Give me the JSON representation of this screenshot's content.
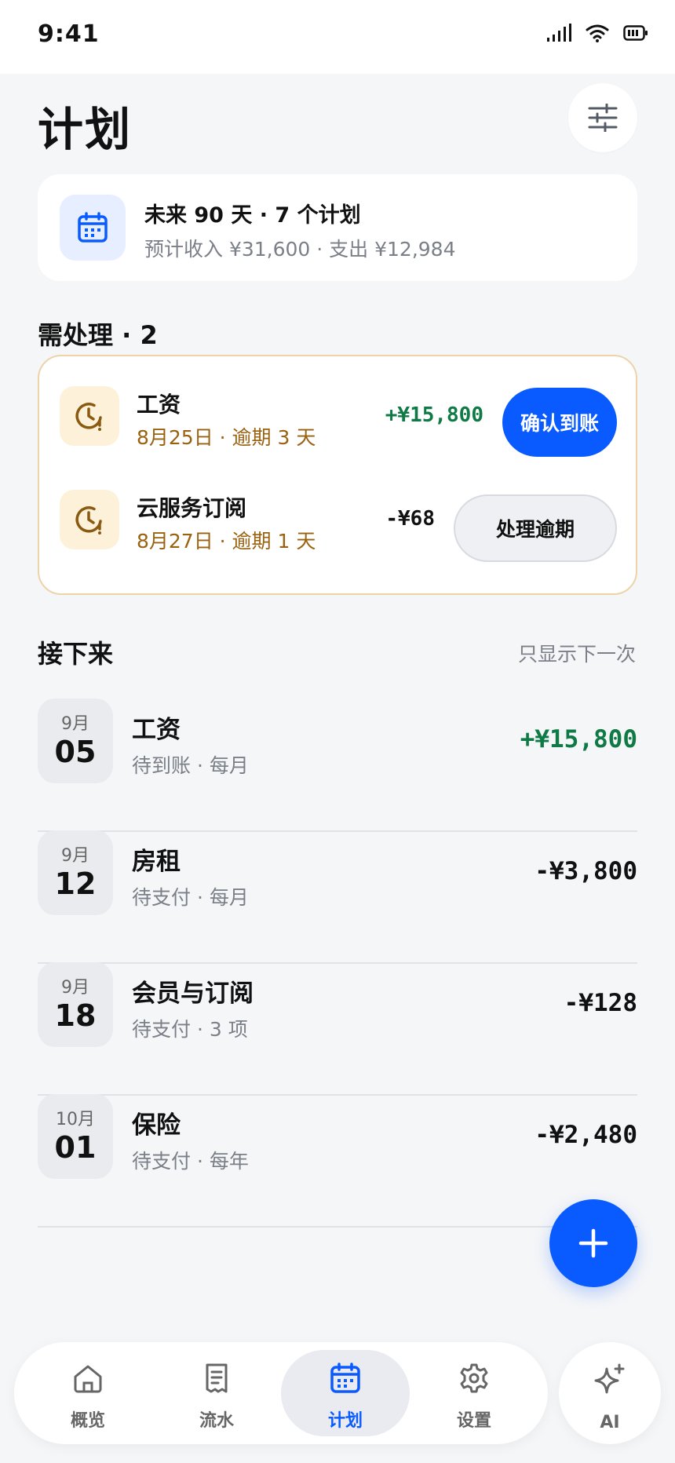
{
  "status_bar": {
    "time": "9:41"
  },
  "header": {
    "title": "计划",
    "filter_icon": "sliders-icon"
  },
  "summary": {
    "title": "未来 90 天 · 7 个计划",
    "subtitle": "预计收入 ¥31,600 · 支出 ¥12,984",
    "icon": "calendar-icon"
  },
  "attention": {
    "title": "需处理 · 2",
    "items": [
      {
        "name": "工资",
        "meta": "8月25日 · 逾期 3 天",
        "amount": "+¥15,800",
        "action": "确认到账"
      },
      {
        "name": "云服务订阅",
        "meta": "8月27日 · 逾期 1 天",
        "amount": "-¥68",
        "action": "处理逾期"
      }
    ]
  },
  "upcoming": {
    "title": "接下来",
    "filter_label": "只显示下一次",
    "items": [
      {
        "month": "9月",
        "day": "05",
        "name": "工资",
        "meta": "待到账 · 每月",
        "amount": "+¥15,800"
      },
      {
        "month": "9月",
        "day": "12",
        "name": "房租",
        "meta": "待支付 · 每月",
        "amount": "-¥3,800"
      },
      {
        "month": "9月",
        "day": "18",
        "name": "会员与订阅",
        "meta": "待支付 · 3 项",
        "amount": "-¥128"
      },
      {
        "month": "10月",
        "day": "01",
        "name": "保险",
        "meta": "待支付 · 每年",
        "amount": "-¥2,480"
      }
    ]
  },
  "tabs": [
    {
      "label": "概览",
      "icon": "home-icon"
    },
    {
      "label": "流水",
      "icon": "receipt-icon"
    },
    {
      "label": "计划",
      "icon": "calendar-icon",
      "active": true
    },
    {
      "label": "设置",
      "icon": "gear-icon"
    }
  ],
  "ai_button": {
    "label": "AI",
    "icon": "sparkle-icon"
  },
  "colors": {
    "accent": "#0a5bff",
    "income": "#0f7a45",
    "overdue": "#9a6210",
    "overdue_border": "#ecd3a9"
  }
}
